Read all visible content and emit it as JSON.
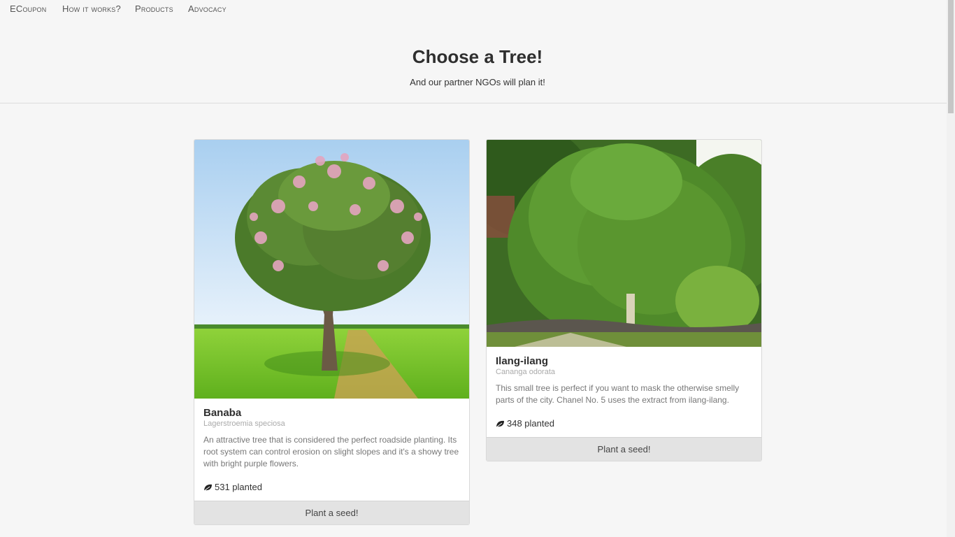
{
  "nav": {
    "items": [
      {
        "label": "ECoupon"
      },
      {
        "label": "How it works?"
      },
      {
        "label": "Products"
      },
      {
        "label": "Advocacy"
      }
    ]
  },
  "hero": {
    "title": "Choose a Tree!",
    "subtitle": "And our partner NGOs will plan it!"
  },
  "cards": [
    {
      "name": "Banaba",
      "scientific": "Lagerstroemia speciosa",
      "description": "An attractive tree that is considered the perfect roadside planting. Its root system can control erosion on slight slopes and it's a showy tree with bright purple flowers.",
      "count": "531 planted",
      "button": "Plant a seed!",
      "count_icon": "leaf-icon"
    },
    {
      "name": "Ilang-ilang",
      "scientific": "Cananga odorata",
      "description": "This small tree is perfect if you want to mask the otherwise smelly parts of the city. Chanel No. 5 uses the extract from ilang-ilang.",
      "count": "348 planted",
      "button": "Plant a seed!",
      "count_icon": "leaf-icon"
    }
  ],
  "colors": {
    "background": "#f6f6f6",
    "button_bg": "#e3e3e3",
    "text_dark": "#2e2e2e",
    "text_muted": "#777777"
  }
}
